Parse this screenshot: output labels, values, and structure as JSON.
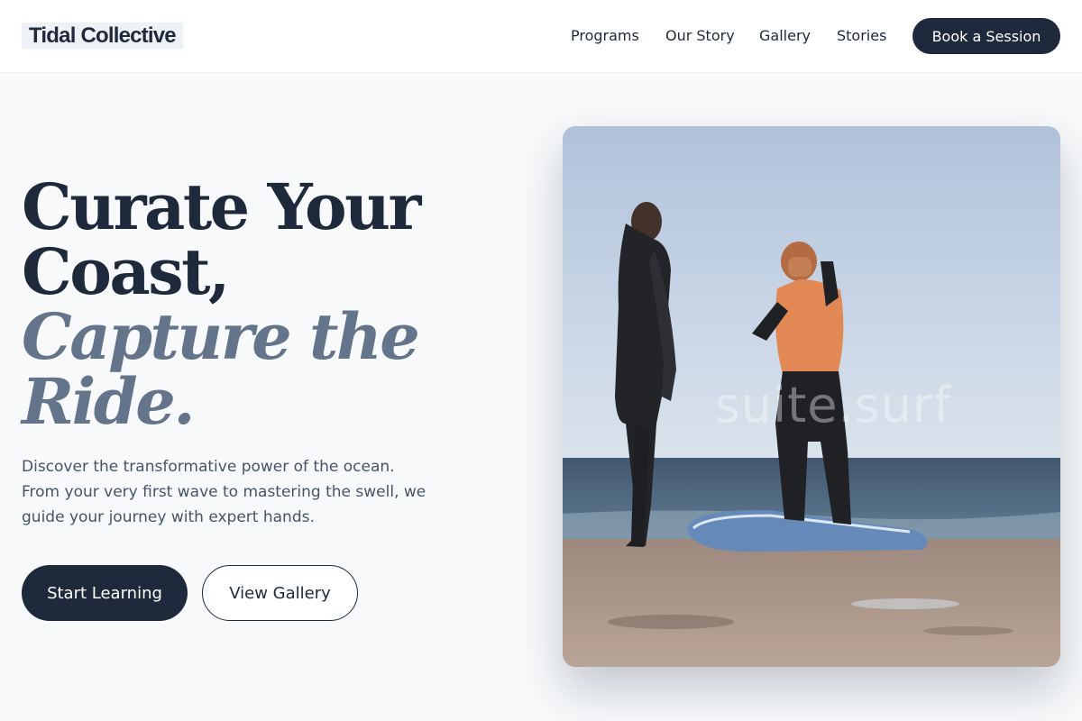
{
  "header": {
    "logo": "Tidal Collective",
    "nav": [
      "Programs",
      "Our Story",
      "Gallery",
      "Stories"
    ],
    "cta": "Book a Session"
  },
  "hero": {
    "headline_line1": "Curate Your",
    "headline_line2": "Coast,",
    "headline_line3": "Capture the",
    "headline_line4": "Ride.",
    "description": "Discover the transformative power of the ocean. From your very first wave to mastering the swell, we guide your journey with expert hands.",
    "primary_button": "Start Learning",
    "secondary_button": "View Gallery",
    "image_watermark": "suite.surf"
  },
  "colors": {
    "primary": "#1e293b",
    "accent_text": "#64748b",
    "background": "#f7f9fb"
  }
}
